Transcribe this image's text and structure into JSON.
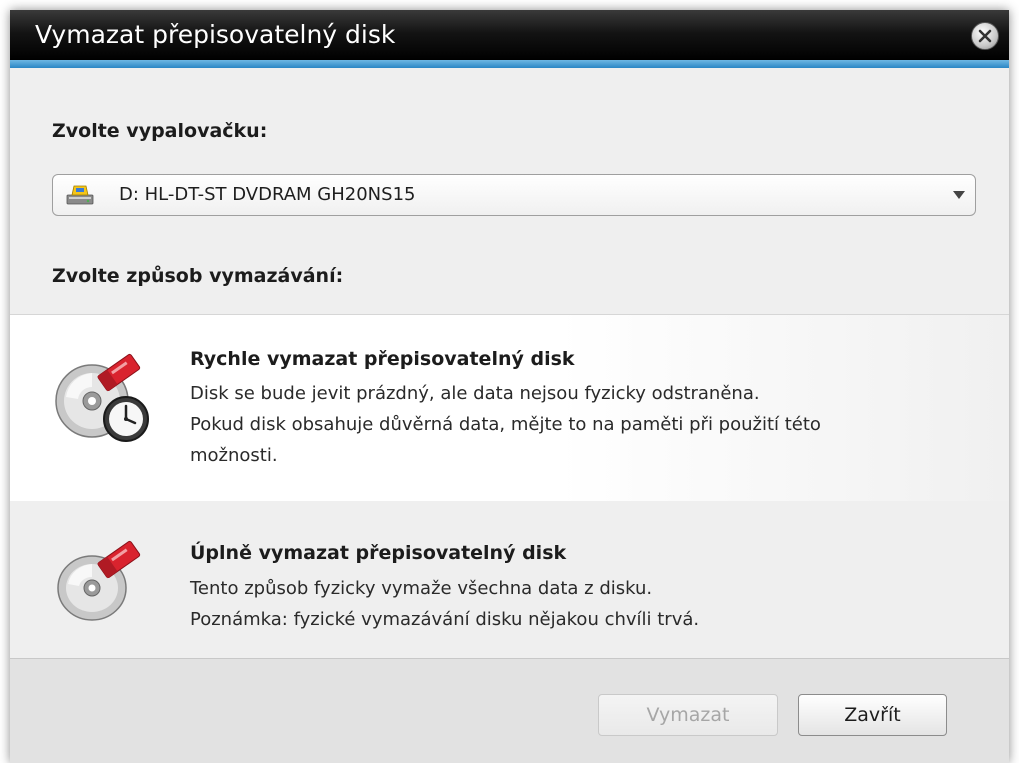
{
  "window": {
    "title": "Vymazat přepisovatelný disk",
    "close_icon": "close-icon"
  },
  "drive": {
    "label": "Zvolte vypalovačku:",
    "selected": "D: HL-DT-ST DVDRAM GH20NS15",
    "icon": "optical-drive-icon"
  },
  "method": {
    "label": "Zvolte způsob vymazávání:",
    "options": [
      {
        "title": "Rychle vymazat přepisovatelný disk",
        "lines": [
          "Disk se bude jevit prázdný, ale data nejsou fyzicky odstraněna.",
          "Pokud disk obsahuje důvěrná data, mějte to na paměti při použití této",
          "možnosti."
        ],
        "icon": "quick-erase-disc-icon"
      },
      {
        "title": "Úplně vymazat přepisovatelný disk",
        "lines": [
          "Tento způsob fyzicky vymaže všechna data z disku.",
          "Poznámka: fyzické vymazávání disku nějakou chvíli trvá."
        ],
        "icon": "full-erase-disc-icon"
      }
    ]
  },
  "buttons": {
    "erase": "Vymazat",
    "close": "Zavřít"
  },
  "colors": {
    "title_bar": "#000000",
    "accent": "#2a86c4",
    "background": "#efefef"
  }
}
